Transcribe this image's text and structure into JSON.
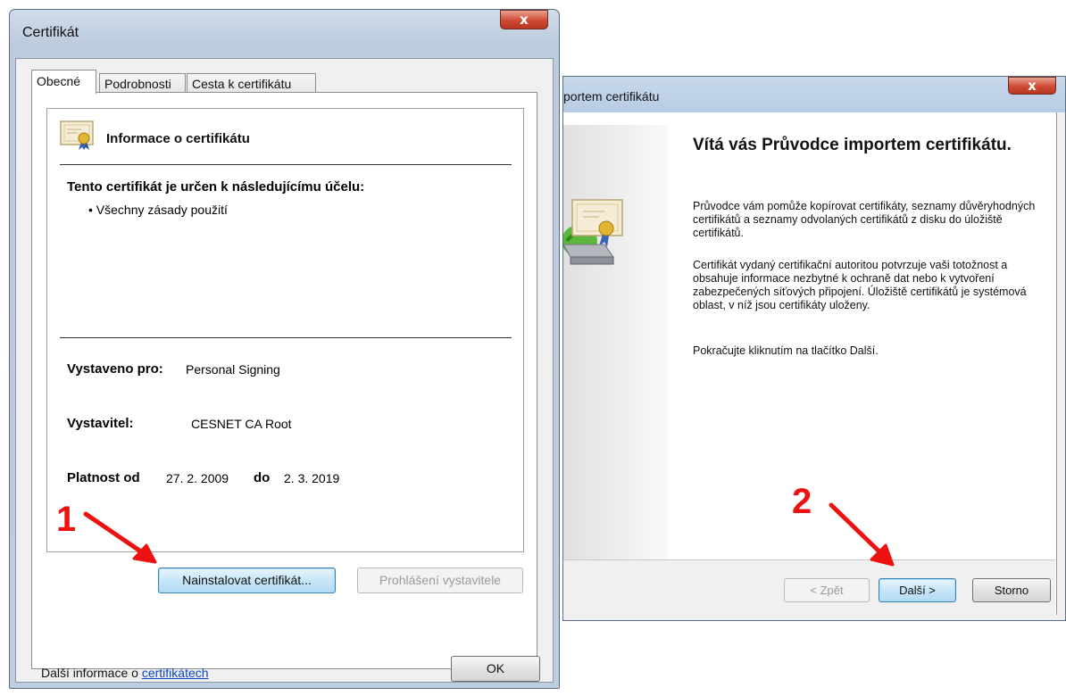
{
  "cert_window": {
    "title": "Certifikát",
    "close_label": "x",
    "tabs": [
      {
        "label": "Obecné"
      },
      {
        "label": "Podrobnosti"
      },
      {
        "label": "Cesta k certifikátu"
      }
    ],
    "info_title": "Informace o certifikátu",
    "purpose_title": "Tento certifikát je určen k následujícímu účelu:",
    "purpose_items": [
      "• Všechny zásady použití"
    ],
    "issued_to_label": "Vystaveno pro:",
    "issued_to_value": "Personal Signing",
    "issuer_label": "Vystavitel:",
    "issuer_value": "CESNET CA Root",
    "validity_label": "Platnost od",
    "valid_from": "27. 2. 2009",
    "validity_to_label": "do",
    "valid_to": "2. 3. 2019",
    "install_button": "Nainstalovat certifikát...",
    "issuer_statement_button": "Prohlášení vystavitele",
    "more_info_text": "Další informace o ",
    "more_info_link": "certifikátech",
    "ok_button": "OK"
  },
  "wizard_window": {
    "title": "portem certifikátu",
    "close_label": "x",
    "heading": "Vítá vás Průvodce importem certifikátu.",
    "paragraphs": [
      "Průvodce vám pomůže kopírovat certifikáty, seznamy důvěryhodných certifikátů a seznamy odvolaných certifikátů z disku do úložiště certifikátů.",
      "Certifikát vydaný certifikační autoritou potvrzuje vaši totožnost a obsahuje informace nezbytné k ochraně dat nebo k vytvoření zabezpečených síťových připojení. Úložiště certifikátů je systémová oblast, v níž jsou certifikáty uloženy.",
      "Pokračujte kliknutím na tlačítko Další."
    ],
    "back_button": "< Zpět",
    "next_button": "Další >",
    "cancel_button": "Storno"
  },
  "annotations": {
    "step1": "1",
    "step2": "2",
    "color": "#e11111"
  }
}
